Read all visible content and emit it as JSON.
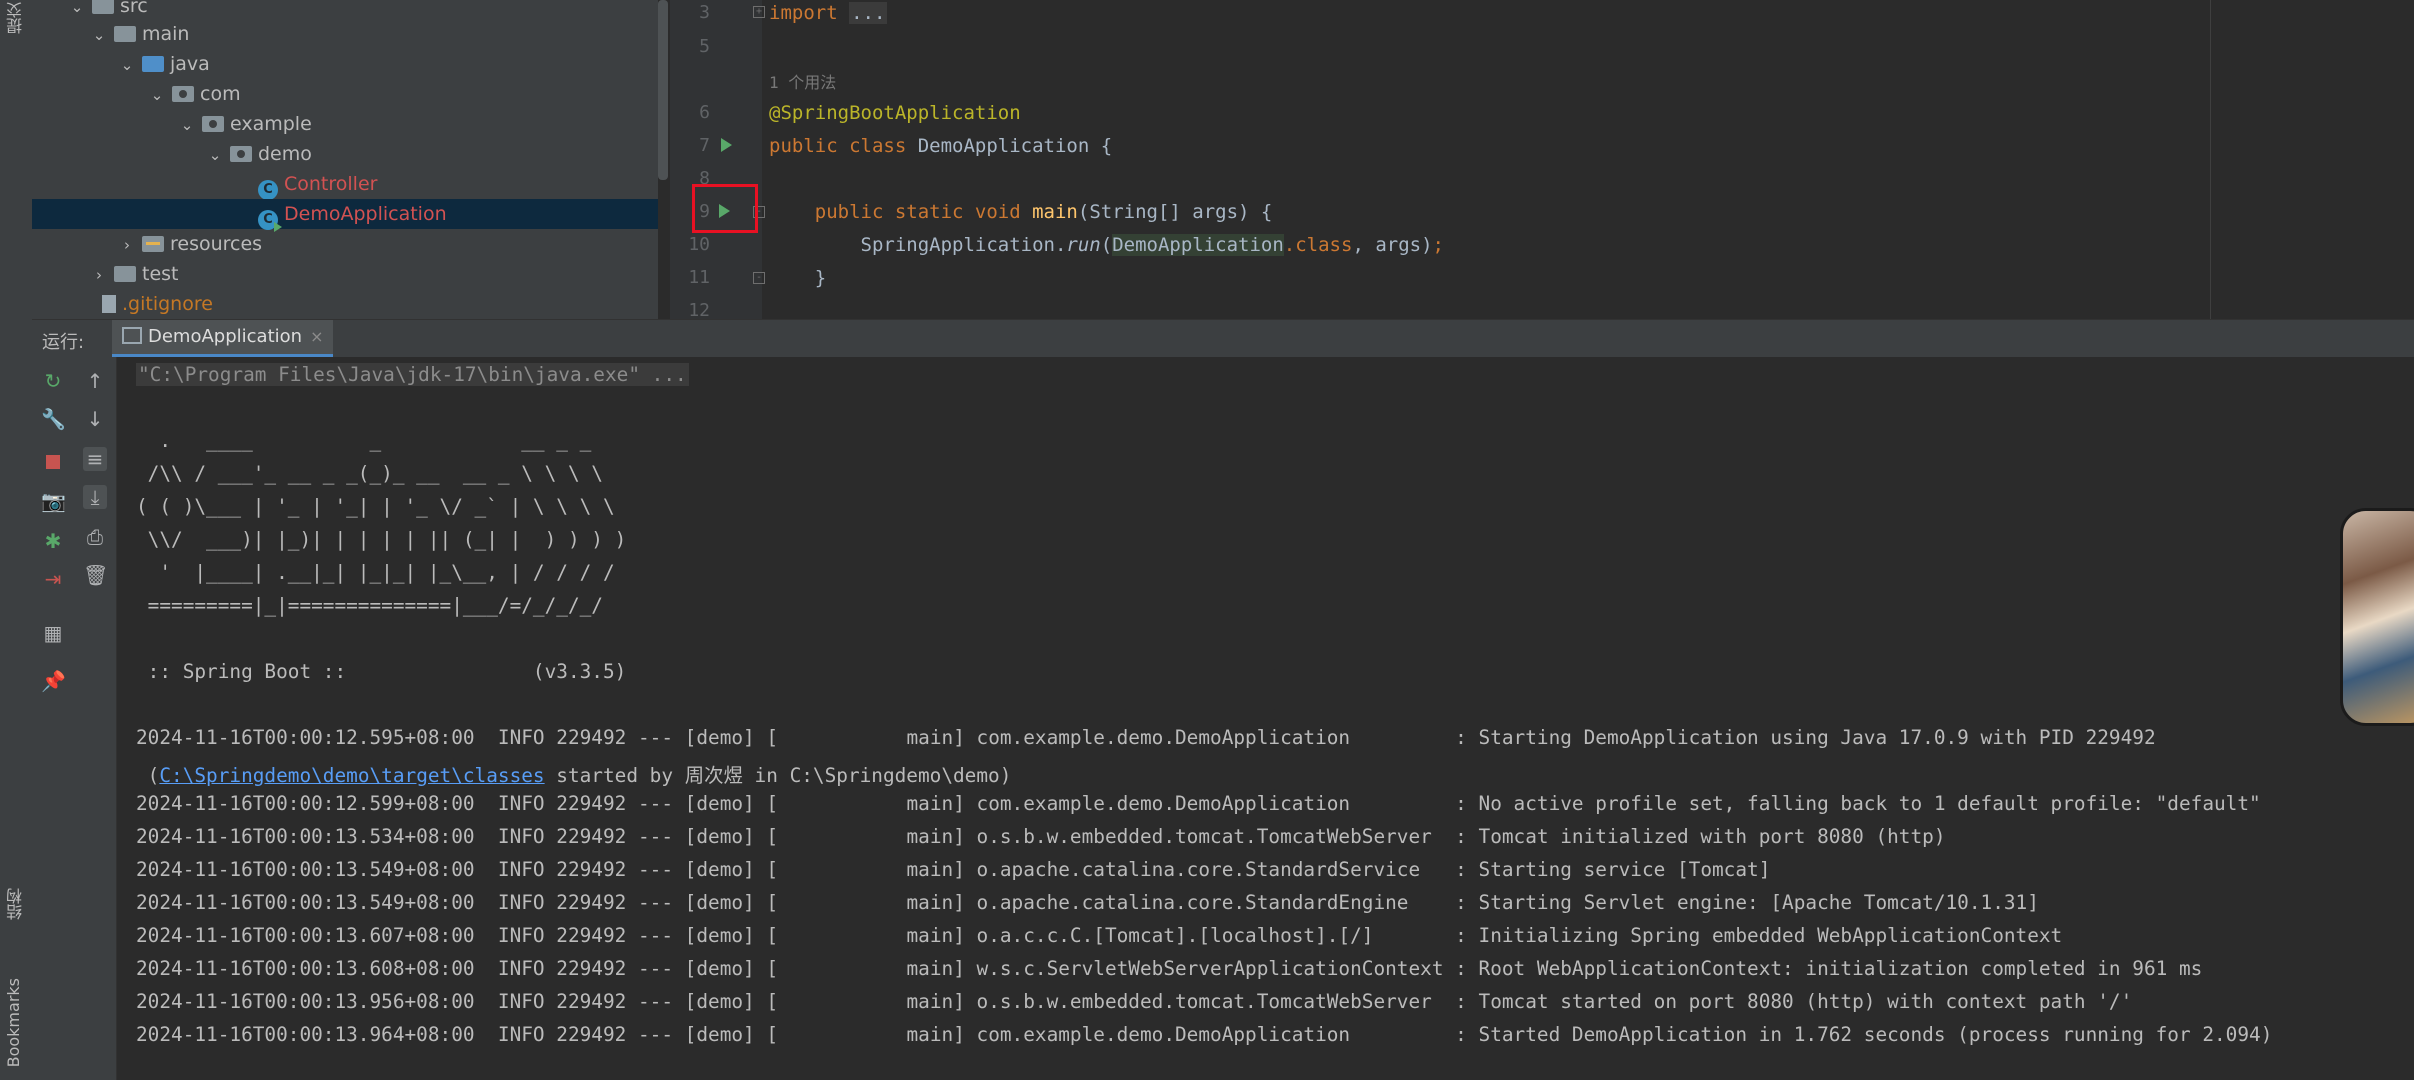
{
  "sidebar": {
    "top_label": "提交",
    "structure_label": "结构",
    "bookmarks_label": "Bookmarks"
  },
  "project_tree": {
    "items": [
      {
        "label": "src",
        "kind": "folder"
      },
      {
        "label": "main",
        "kind": "folder"
      },
      {
        "label": "java",
        "kind": "source-folder"
      },
      {
        "label": "com",
        "kind": "package"
      },
      {
        "label": "example",
        "kind": "package"
      },
      {
        "label": "demo",
        "kind": "package"
      },
      {
        "label": "Controller",
        "kind": "class"
      },
      {
        "label": "DemoApplication",
        "kind": "class-runnable",
        "selected": true
      },
      {
        "label": "resources",
        "kind": "resources-folder"
      },
      {
        "label": "test",
        "kind": "folder"
      },
      {
        "label": ".gitignore",
        "kind": "file"
      }
    ]
  },
  "editor": {
    "line_numbers": [
      "3",
      "5",
      "6",
      "7",
      "8",
      "9",
      "10",
      "11",
      "12"
    ],
    "usage_hint": "1 个用法",
    "code": {
      "l3_kw": "import",
      "l3_fold": "...",
      "l6_ann": "@SpringBootApplication",
      "l7_kw": "public class ",
      "l7_class": "DemoApplication",
      "l7_rest": " {",
      "l9_kw": "public static void ",
      "l9_meth": "main",
      "l9_rest": "(String[] args) {",
      "l10_a": "SpringApplication.",
      "l10_meth": "run",
      "l10_b": "(",
      "l10_class": "DemoApplication",
      "l10_kw": ".class",
      "l10_c": ", args)",
      "l10_semi": ";",
      "l11": "}"
    }
  },
  "run_window": {
    "label": "运行:",
    "tab_label": "DemoApplication",
    "tab_close": "×"
  },
  "console": {
    "command": "\"C:\\Program Files\\Java\\jdk-17\\bin\\java.exe\" ...",
    "banner": [
      "  .   ____          _            __ _ _",
      " /\\\\ / ___'_ __ _ _(_)_ __  __ _ \\ \\ \\ \\",
      "( ( )\\___ | '_ | '_| | '_ \\/ _` | \\ \\ \\ \\",
      " \\\\/  ___)| |_)| | | | | || (_| |  ) ) ) )",
      "  '  |____| .__|_| |_|_| |_\\__, | / / / /",
      " =========|_|==============|___/=/_/_/_/"
    ],
    "spring_boot_line": " :: Spring Boot ::                (v3.3.5)",
    "log_line_1": "2024-11-16T00:00:12.595+08:00  INFO 229492 --- [demo] [           main] com.example.demo.DemoApplication         : Starting DemoApplication using Java 17.0.9 with PID 229492",
    "log_line_1b_pre": " (",
    "log_line_1b_link": "C:\\Springdemo\\demo\\target\\classes",
    "log_line_1b_post": " started by 周次煜 in C:\\Springdemo\\demo)",
    "log_lines": [
      "2024-11-16T00:00:12.599+08:00  INFO 229492 --- [demo] [           main] com.example.demo.DemoApplication         : No active profile set, falling back to 1 default profile: \"default\"",
      "2024-11-16T00:00:13.534+08:00  INFO 229492 --- [demo] [           main] o.s.b.w.embedded.tomcat.TomcatWebServer  : Tomcat initialized with port 8080 (http)",
      "2024-11-16T00:00:13.549+08:00  INFO 229492 --- [demo] [           main] o.apache.catalina.core.StandardService   : Starting service [Tomcat]",
      "2024-11-16T00:00:13.549+08:00  INFO 229492 --- [demo] [           main] o.apache.catalina.core.StandardEngine    : Starting Servlet engine: [Apache Tomcat/10.1.31]",
      "2024-11-16T00:00:13.607+08:00  INFO 229492 --- [demo] [           main] o.a.c.c.C.[Tomcat].[localhost].[/]       : Initializing Spring embedded WebApplicationContext",
      "2024-11-16T00:00:13.608+08:00  INFO 229492 --- [demo] [           main] w.s.c.ServletWebServerApplicationContext : Root WebApplicationContext: initialization completed in 961 ms",
      "2024-11-16T00:00:13.956+08:00  INFO 229492 --- [demo] [           main] o.s.b.w.embedded.tomcat.TomcatWebServer  : Tomcat started on port 8080 (http) with context path '/'",
      "2024-11-16T00:00:13.964+08:00  INFO 229492 --- [demo] [           main] com.example.demo.DemoApplication         : Started DemoApplication in 1.762 seconds (process running for 2.094)"
    ]
  },
  "colors": {
    "accent": "#4a88c7",
    "run_green": "#59a869",
    "highlight_red": "#e81123"
  },
  "icons": {
    "rerun": "rerun-icon",
    "stop": "stop-icon",
    "settings": "wrench-icon",
    "screenshot": "camera-icon",
    "debug": "debug-icon",
    "exit": "exit-icon",
    "layout": "layout-icon",
    "pin": "pin-icon"
  }
}
